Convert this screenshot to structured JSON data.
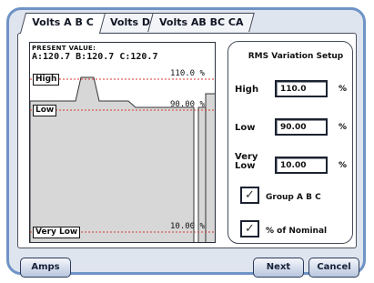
{
  "tabs": [
    {
      "label": "Volts A B C",
      "active": true
    },
    {
      "label": "Volts D",
      "active": false
    },
    {
      "label": "Volts AB BC CA",
      "active": false
    }
  ],
  "plot": {
    "present_value_label": "PRESENT VALUE:",
    "present_value_readout": "A:120.7  B:120.7  C:120.7",
    "high_tag": "High",
    "low_tag": "Low",
    "very_low_tag": "Very Low",
    "high_pct": "110.0 %",
    "low_pct": "90.00 %",
    "very_low_pct": "10.00 %"
  },
  "setup": {
    "title": "RMS Variation Setup",
    "high_label": "High",
    "high_value": "110.0",
    "low_label": "Low",
    "low_value": "90.00",
    "very_label": "Very",
    "low_word": "Low",
    "very_low_value": "10.00",
    "unit": "%",
    "group_label": "Group A B C",
    "group_checked": true,
    "nominal_label": "% of Nominal",
    "nominal_checked": true
  },
  "buttons": {
    "amps": "Amps",
    "next": "Next",
    "cancel": "Cancel"
  },
  "colors": {
    "frame": "#6f93c6",
    "limit_line": "#d63a2e",
    "waveform_fill": "#d7d7d7"
  }
}
